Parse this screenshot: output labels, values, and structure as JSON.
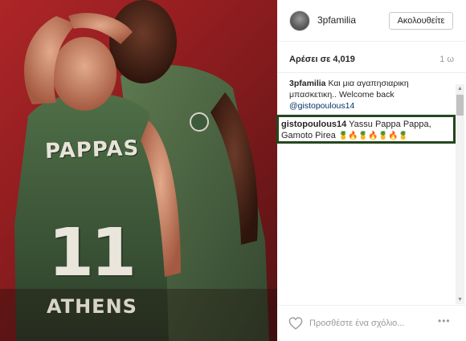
{
  "post": {
    "photo": {
      "jersey_name": "PAPPAS",
      "jersey_number": "11",
      "jersey_city": "ATHENS"
    },
    "header": {
      "username": "3pfamilia",
      "follow_label": "Ακολουθείτε"
    },
    "stats": {
      "likes": "Αρέσει σε 4,019",
      "time": "1 ω"
    },
    "caption": {
      "author": "3pfamilia",
      "text": "Και μια αγαπησιαρικη μπασκετικη.. Welcome back",
      "mention": "@gistopoulous14"
    },
    "highlighted_comment": {
      "author": "gistopoulous14",
      "text": "Yassu Pappa Pappa, Gamoto Pirea",
      "emoji_sequence": "🍍🔥🍍🔥🍍🔥🍍"
    },
    "footer": {
      "comment_placeholder": "Προσθέστε ένα σχόλιο...",
      "more_label": "•••"
    }
  },
  "colors": {
    "highlight_border": "#24471e",
    "jersey_green": "#3d5b3a",
    "background_red": "#b7282a",
    "mention_link": "#003569"
  }
}
